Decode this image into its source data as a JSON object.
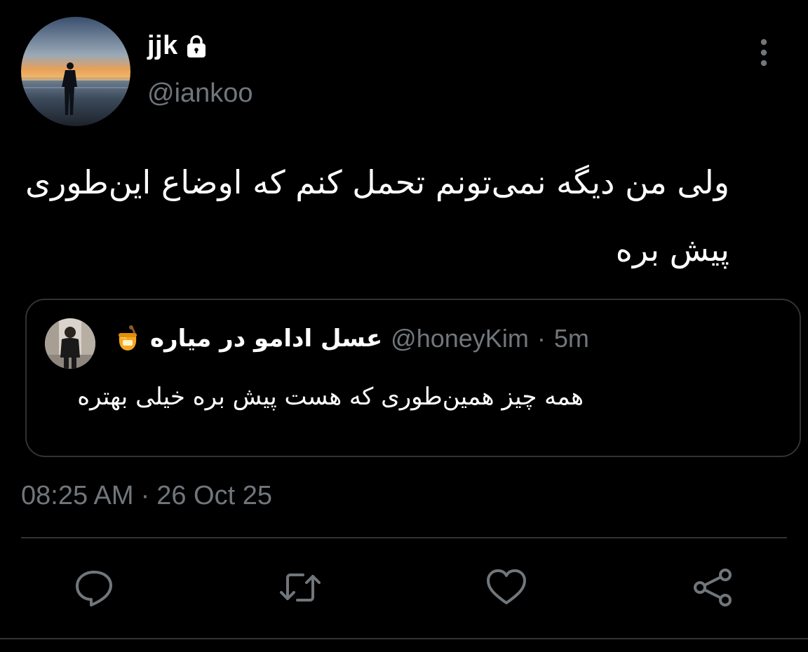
{
  "author": {
    "display_name": "jjk",
    "handle": "@iankoo",
    "avatar_icon": "sunset-silhouette-avatar",
    "lock_icon": "lock-icon"
  },
  "tweet": {
    "text": "ولی من دیگه نمی‌تونم تحمل کنم که اوضاع این‌طوری پیش بره",
    "timestamp_time": "08:25 AM",
    "timestamp_sep": "·",
    "timestamp_date": "26 Oct 25"
  },
  "quote": {
    "display_name": "عسل ادامو در میاره",
    "emoji_icon": "honey-pot-icon",
    "handle": "@honeyKim",
    "sep": "·",
    "time": "5m",
    "text": "همه چیز همین‌طوری که هست پیش بره خیلی بهتره"
  },
  "actions": {
    "reply_icon": "reply-icon",
    "retweet_icon": "retweet-icon",
    "like_icon": "like-icon",
    "share_icon": "share-icon"
  },
  "colors": {
    "background": "#000000",
    "text_primary": "#ffffff",
    "text_secondary": "#71767b",
    "border": "#2f3336"
  }
}
